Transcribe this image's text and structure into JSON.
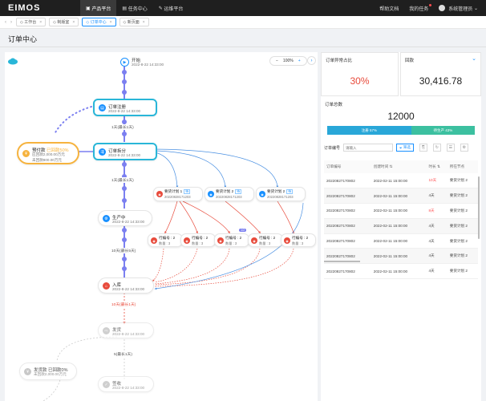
{
  "header": {
    "logo": "EIMOS",
    "nav": [
      {
        "label": "产品平台",
        "icon": "box-icon"
      },
      {
        "label": "任务中心",
        "icon": "task-icon"
      },
      {
        "label": "运维平台",
        "icon": "wrench-icon"
      }
    ],
    "help": "帮助文档",
    "tasks": "我的任务",
    "user": "系统管理员"
  },
  "tabs": [
    {
      "label": "工作台"
    },
    {
      "label": "制版室"
    },
    {
      "label": "订单中心"
    },
    {
      "label": "新页面"
    }
  ],
  "page_title": "订单中心",
  "flow": {
    "zoom": "100%",
    "start": {
      "title": "开始",
      "time": "2022-8-22 14:33:00"
    },
    "register": {
      "title": "订单注册",
      "time": "2022-8-22 14:33:00"
    },
    "split": {
      "title": "订单拆分",
      "time": "2022-8-22 14:33:00"
    },
    "prepay": {
      "title": "预付款",
      "status": "已回款50%",
      "line1": "应回款2,000.00万元",
      "line2": "未回款800.00万元"
    },
    "edge1": "1天(最长1天)",
    "edge2": "1天(最长1天)",
    "edge3": "10天(最长5天)",
    "edge4": "10天(最长1天)",
    "edge5": "5(最长1天)",
    "produce": {
      "title": "生产中",
      "time": "2022-8-22 14:33:00"
    },
    "storage": {
      "title": "入库",
      "time": "2022-8-22 14:33:00"
    },
    "ship": {
      "title": "发货",
      "time": "2022-8-22 14:33:00"
    },
    "receive": {
      "title": "签收",
      "time": "2022-8-22 14:33:00"
    },
    "delivery": {
      "title": "发货款",
      "status": "已回款0%",
      "line1": "未回款2,000.00万元"
    },
    "plans": [
      {
        "title": "要货计划 1",
        "tag": "待",
        "code": "20220828171203"
      },
      {
        "title": "要货计划 2",
        "tag": "待",
        "code": "20220828171203"
      },
      {
        "title": "要货计划 2",
        "tag": "待",
        "code": "20220828171203"
      }
    ],
    "rows": [
      {
        "title": "行编号 : 2",
        "qty": "数量 : 3"
      },
      {
        "title": "行编号 : 2",
        "qty": "数量 : 3"
      },
      {
        "title": "行编号 : 2",
        "qty": "数量 : 3"
      },
      {
        "title": "行编号 : 2",
        "qty": "数量 : 3"
      },
      {
        "title": "行编号 : 2",
        "qty": "数量 : 3"
      }
    ],
    "badge": "1/2"
  },
  "stats": {
    "abnormal_label": "订单异常占比",
    "abnormal_value": "30%",
    "payment_label": "回款",
    "payment_value": "30,416.78",
    "total_label": "订单总数",
    "total_value": "12000",
    "bar1_label": "注册 57%",
    "bar1_pct": 57,
    "bar2_label": "待生产 43%",
    "bar2_pct": 43
  },
  "filter": {
    "label": "订单编号",
    "placeholder": "请输入",
    "button": "筛选"
  },
  "table": {
    "headers": [
      "订单编号",
      "创建时间",
      "时长",
      "所在节点"
    ],
    "rows": [
      {
        "id": "20220827170802",
        "time": "2022-02-11 15:00:00",
        "dur": "10天",
        "node": "要货计划 2",
        "red": true
      },
      {
        "id": "20220827170802",
        "time": "2022-02-11 15:00:00",
        "dur": "4天",
        "node": "要货计划 2",
        "red": false
      },
      {
        "id": "20220827170802",
        "time": "2022-02-11 15:00:00",
        "dur": "8天",
        "node": "要货计划 2",
        "red": true
      },
      {
        "id": "20220827170802",
        "time": "2022-02-11 15:00:00",
        "dur": "4天",
        "node": "要货计划 2",
        "red": false
      },
      {
        "id": "20220827170802",
        "time": "2022-02-11 15:00:00",
        "dur": "4天",
        "node": "要货计划 2",
        "red": false
      },
      {
        "id": "20220827170802",
        "time": "2022-02-11 15:00:00",
        "dur": "4天",
        "node": "要货计划 2",
        "red": false
      },
      {
        "id": "20220827170802",
        "time": "2022-02-11 15:00:00",
        "dur": "4天",
        "node": "要货计划 2",
        "red": false
      }
    ]
  }
}
